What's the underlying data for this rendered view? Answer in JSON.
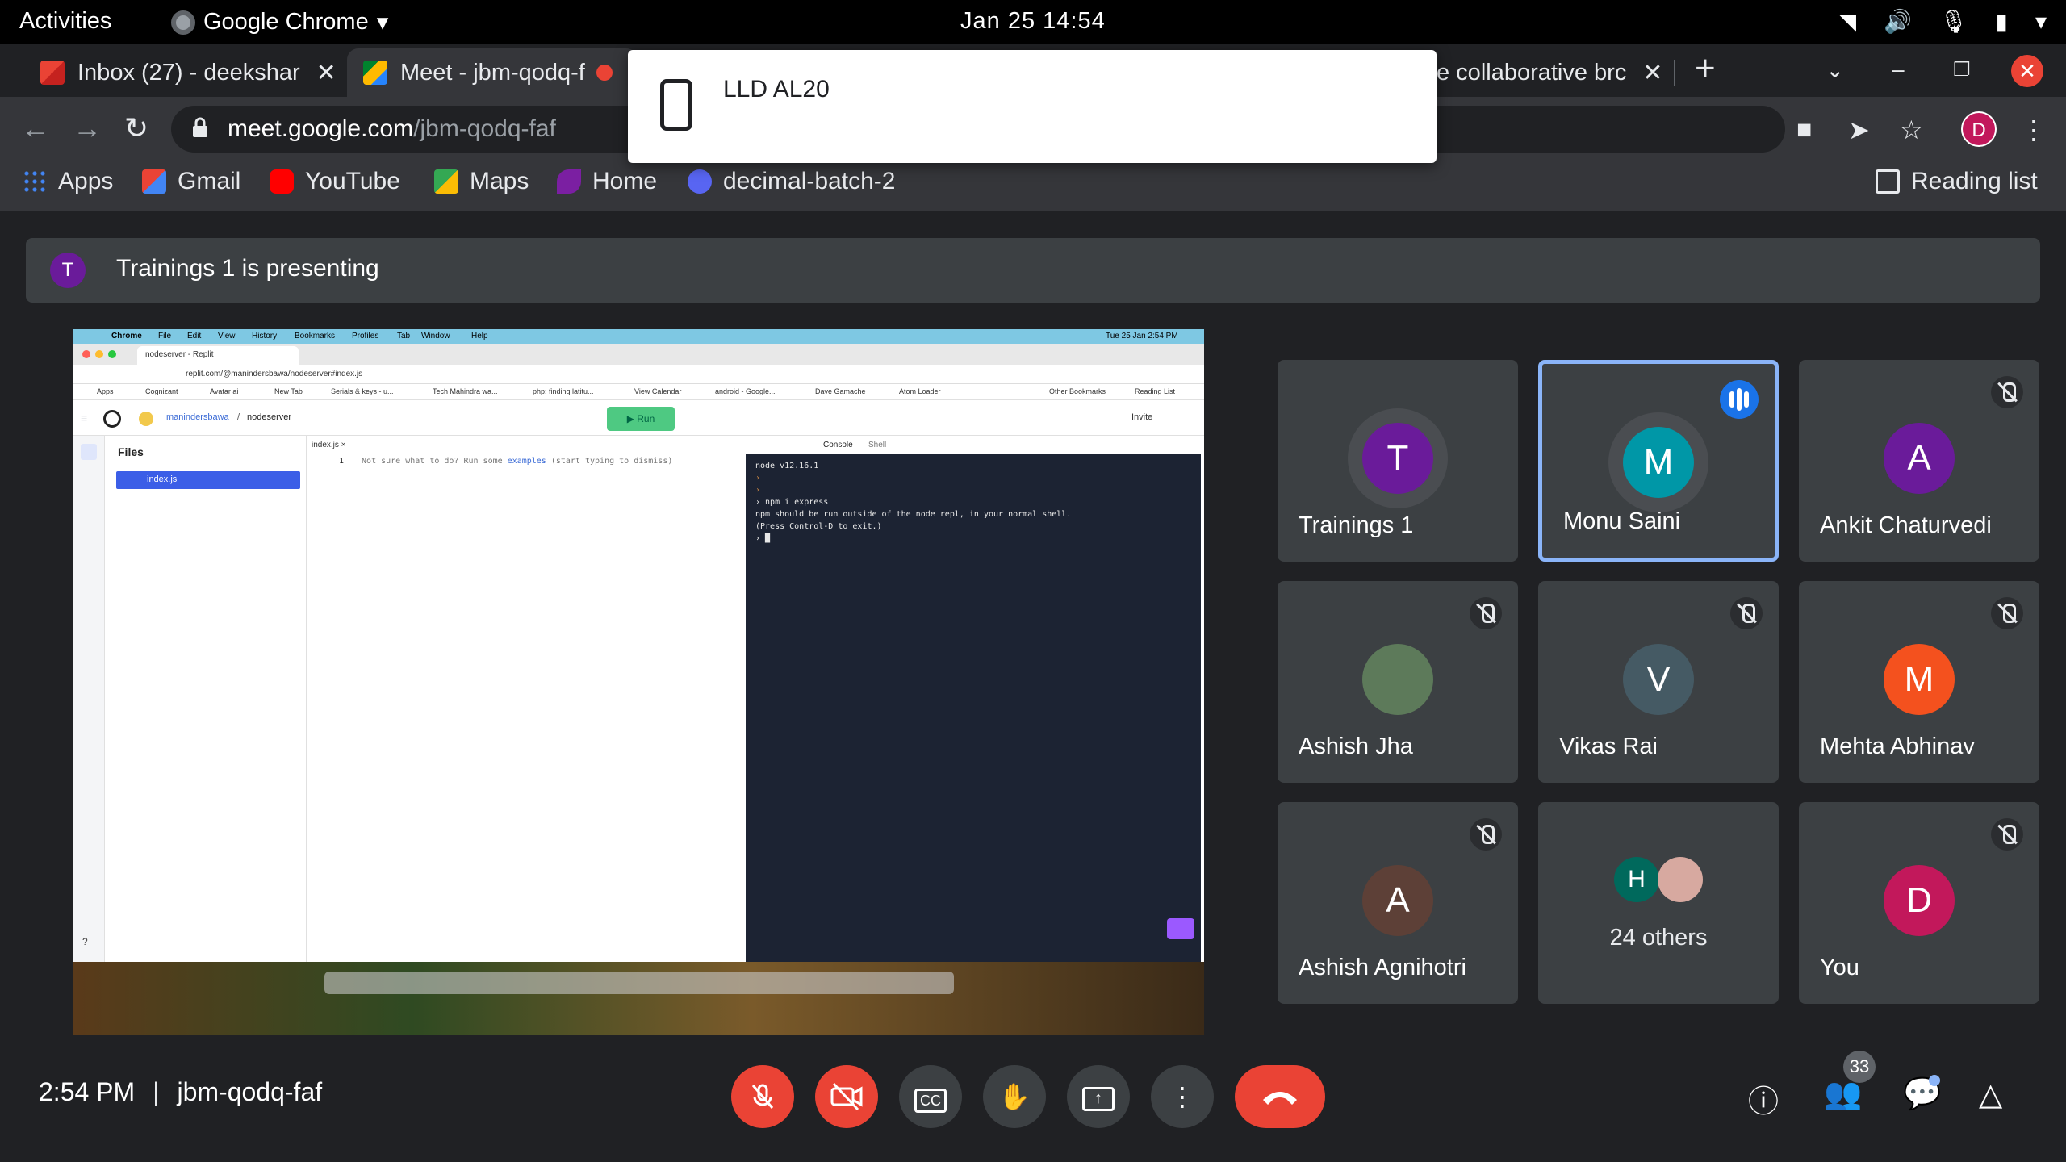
{
  "topbar": {
    "activities": "Activities",
    "app_name": "Google Chrome",
    "clock": "Jan 25  14:54"
  },
  "tabs": [
    {
      "title": "Inbox (27) - deekshar",
      "close": "✕"
    },
    {
      "title": "Meet - jbm-qodq-f",
      "close": ""
    },
    {
      "title": "e collaborative brc",
      "close": "✕"
    }
  ],
  "tab_plus": "+",
  "address": {
    "host": "meet.google.com",
    "path": "/jbm-qodq-faf"
  },
  "profile_initial": "D",
  "bookmarks": [
    {
      "label": "Apps"
    },
    {
      "label": "Gmail"
    },
    {
      "label": "YouTube"
    },
    {
      "label": "Maps"
    },
    {
      "label": "Home"
    },
    {
      "label": "decimal-batch-2"
    }
  ],
  "reading_list": "Reading list",
  "popup": {
    "device_name": "LLD AL20"
  },
  "presenting": {
    "initial": "T",
    "text": "Trainings 1 is presenting"
  },
  "shared_screen": {
    "menubar": [
      "Chrome",
      "File",
      "Edit",
      "View",
      "History",
      "Bookmarks",
      "Profiles",
      "Tab",
      "Window",
      "Help"
    ],
    "menubar_clock": "Tue 25 Jan  2:54 PM",
    "tab_title": "nodeserver - Replit",
    "url": "replit.com/@manindersbawa/nodeserver#index.js",
    "bookmarks": [
      "Apps",
      "Cognizant",
      "Avatar ai",
      "New Tab",
      "Serials & keys - u...",
      "Tech Mahindra wa...",
      "php: finding latitu...",
      "View Calendar",
      "android - Google...",
      "Dave Gamache",
      "Atom Loader",
      "Other Bookmarks",
      "Reading List"
    ],
    "repl_owner": "manindersbawa",
    "repl_name": "nodeserver",
    "run_label": "▶ Run",
    "invite_label": "Invite",
    "files_header": "Files",
    "file_item": "index.js",
    "editor_tab": "index.js ×",
    "editor_line_no": "1",
    "editor_hint": "Not sure what to do? Run some ",
    "editor_hint_link": "examples",
    "editor_hint_tail": " (start typing to dismiss)",
    "console_tabs": [
      "Console",
      "Shell"
    ],
    "console_lines": [
      "node v12.16.1",
      "›",
      "›",
      "› npm i express",
      "npm should be run outside of the node repl, in your normal shell.",
      "(Press Control-D to exit.)",
      "› █"
    ],
    "help": "?"
  },
  "participants": [
    {
      "name": "Trainings 1",
      "initial": "T",
      "color": "#6a1b9a",
      "state": "none"
    },
    {
      "name": "Monu Saini",
      "initial": "M",
      "color": "#0097a7",
      "state": "speaking"
    },
    {
      "name": "Ankit Chaturvedi",
      "initial": "A",
      "color": "#6a1b9a",
      "state": "muted"
    },
    {
      "name": "Ashish Jha",
      "initial": "",
      "color": "#5d7a5a",
      "state": "muted"
    },
    {
      "name": "Vikas Rai",
      "initial": "V",
      "color": "#455a64",
      "state": "muted"
    },
    {
      "name": "Mehta Abhinav",
      "initial": "M",
      "color": "#f4511e",
      "state": "muted"
    },
    {
      "name": "Ashish Agnihotri",
      "initial": "A",
      "color": "#5d4037",
      "state": "muted"
    },
    {
      "name": "24 others",
      "initial": "H",
      "color": "#00695c",
      "state": "others"
    },
    {
      "name": "You",
      "initial": "D",
      "color": "#c2185b",
      "state": "muted"
    }
  ],
  "bottom": {
    "time": "2:54 PM",
    "separator": "|",
    "meeting_code": "jbm-qodq-faf",
    "people_count": "33"
  }
}
